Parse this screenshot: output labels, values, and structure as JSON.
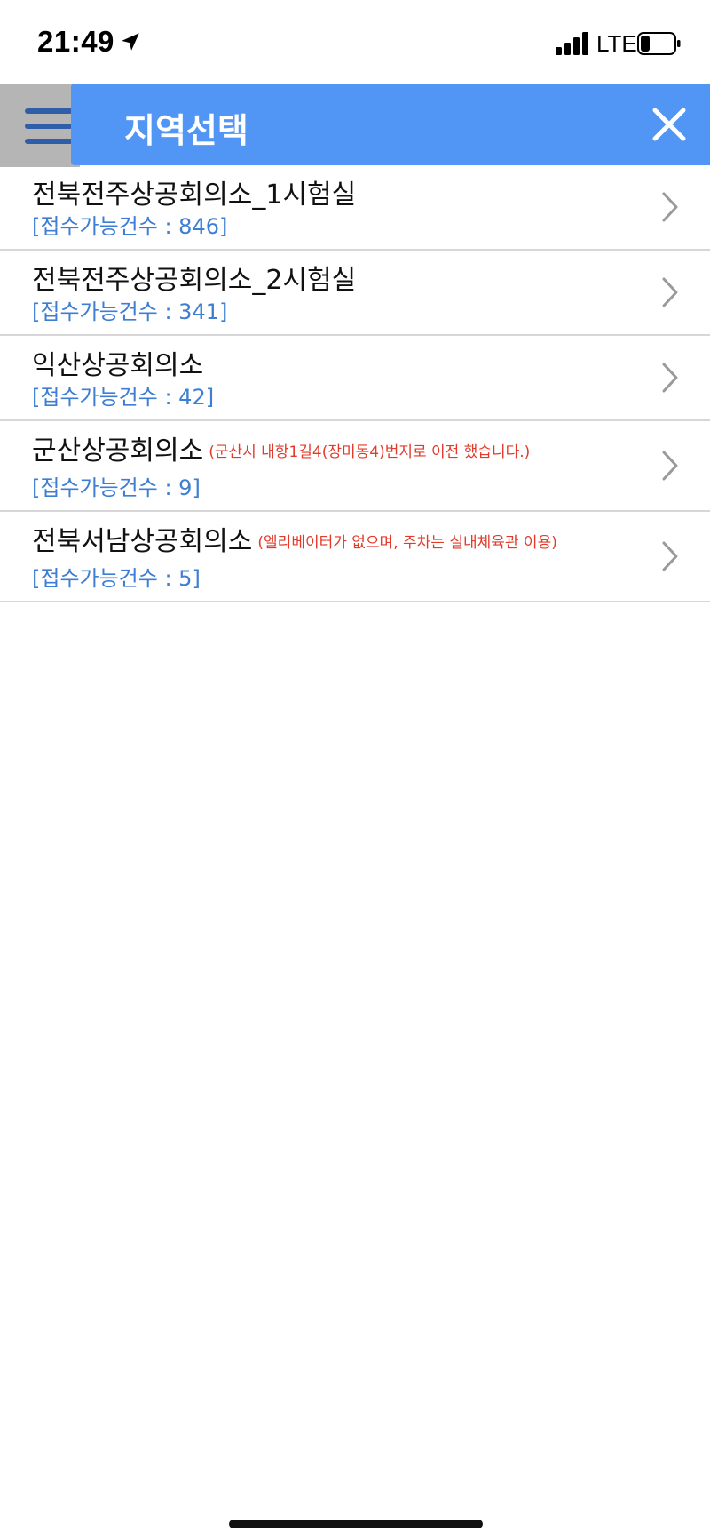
{
  "status_bar": {
    "time": "21:49",
    "network": "LTE"
  },
  "header": {
    "title": "지역선택"
  },
  "regions": [
    {
      "name": "전북전주상공회의소_1시험실",
      "note": "",
      "count_label": "[접수가능건수 : 846]"
    },
    {
      "name": "전북전주상공회의소_2시험실",
      "note": "",
      "count_label": "[접수가능건수 : 341]"
    },
    {
      "name": "익산상공회의소",
      "note": "",
      "count_label": "[접수가능건수 : 42]"
    },
    {
      "name": "군산상공회의소",
      "note": "(군산시 내항1길4(장미동4)번지로 이전 했습니다.)",
      "count_label": "[접수가능건수 : 9]"
    },
    {
      "name": "전북서남상공회의소",
      "note": "(엘리베이터가 없으며, 주차는 실내체육관 이용)",
      "count_label": "[접수가능건수 : 5]"
    }
  ],
  "colors": {
    "header_bg": "#5296f5",
    "count_text": "#3d7ed4",
    "note_text": "#e23a2b",
    "menu_strip": "#b5b5b5"
  }
}
